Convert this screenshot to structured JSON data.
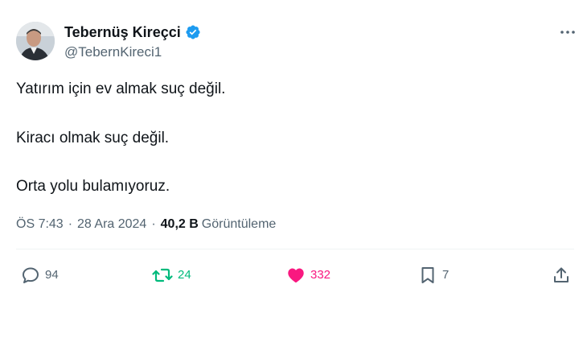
{
  "user": {
    "display_name": "Tebernüş Kireçci",
    "handle": "@TebernKireci1",
    "verified_icon": "verified-badge-icon"
  },
  "tweet": {
    "lines": [
      "Yatırım için ev almak suç değil.",
      "Kiracı olmak suç değil.",
      "Orta yolu bulamıyoruz."
    ]
  },
  "meta": {
    "time": "ÖS 7:43",
    "separator": "·",
    "date": "28 Ara 2024",
    "views_count": "40,2 B",
    "views_label": "Görüntüleme"
  },
  "actions": {
    "replies": "94",
    "retweets": "24",
    "likes": "332",
    "bookmarks": "7"
  },
  "colors": {
    "text": "#0f1419",
    "secondary": "#536471",
    "verified": "#1d9bf0",
    "retweet": "#00ba7c",
    "like": "#f91880"
  }
}
